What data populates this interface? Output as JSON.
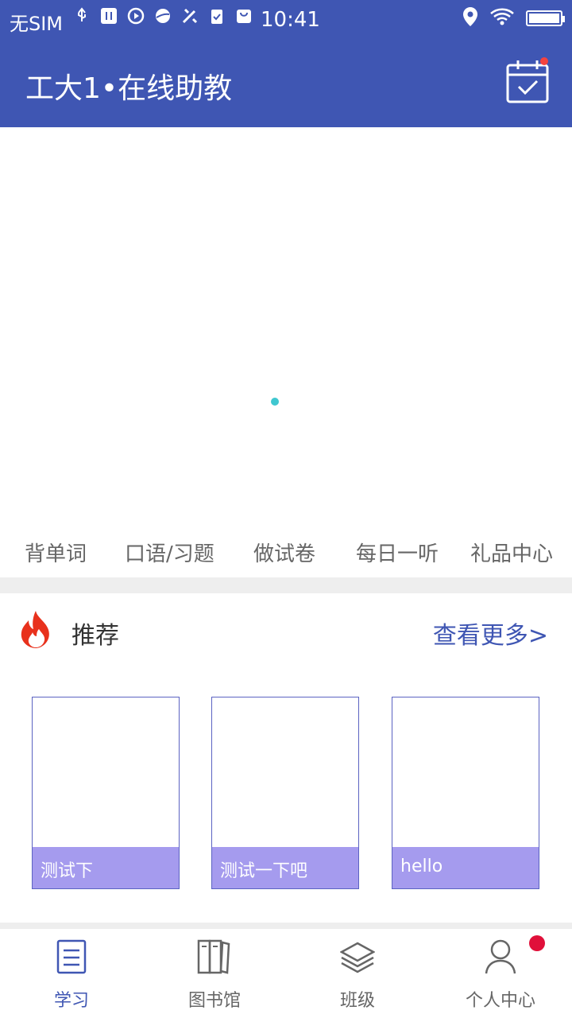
{
  "status_bar": {
    "carrier": "无SIM",
    "time": "10:41",
    "icons": [
      "usb-icon",
      "usb-debug-icon",
      "media-icon",
      "browser-icon",
      "tools-icon",
      "clipboard-icon",
      "bag-icon",
      "location-icon",
      "wifi-icon",
      "battery-icon"
    ]
  },
  "app_bar": {
    "title": "工大1•在线助教",
    "calendar_icon": "calendar-check-icon",
    "has_notification_dot": true
  },
  "banner": {
    "indicator_color": "#3fc7d0"
  },
  "quick_menu": {
    "items": [
      {
        "label": "背单词"
      },
      {
        "label": "口语/习题"
      },
      {
        "label": "做试卷"
      },
      {
        "label": "每日一听"
      },
      {
        "label": "礼品中心"
      }
    ]
  },
  "recommend": {
    "icon": "flame-icon",
    "title": "推荐",
    "more": "查看更多>",
    "items": [
      {
        "label": "测试下"
      },
      {
        "label": "测试一下吧"
      },
      {
        "label": "hello"
      }
    ]
  },
  "tab_bar": {
    "tabs": [
      {
        "label": "学习",
        "icon": "document-icon",
        "active": true
      },
      {
        "label": "图书馆",
        "icon": "books-icon",
        "active": false
      },
      {
        "label": "班级",
        "icon": "layers-icon",
        "active": false
      },
      {
        "label": "个人中心",
        "icon": "person-icon",
        "active": false,
        "badge": true
      }
    ]
  },
  "colors": {
    "primary": "#3f56b3",
    "card_label_bg": "#a59bee",
    "badge": "#e0103a",
    "notification_dot": "#f4433f"
  }
}
